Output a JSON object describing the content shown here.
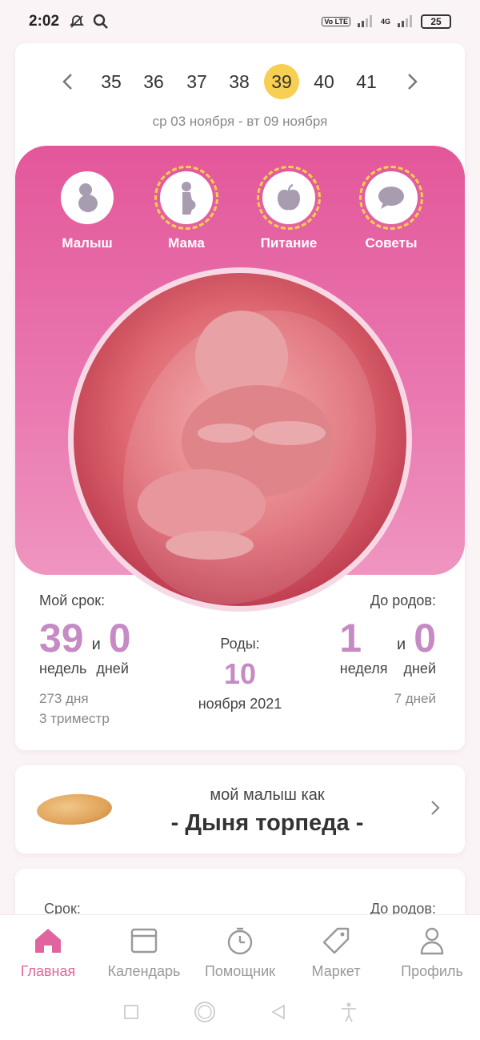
{
  "status_bar": {
    "time": "2:02",
    "network": "4G",
    "volte": "Vo LTE",
    "battery": "25"
  },
  "week_selector": {
    "weeks": [
      "35",
      "36",
      "37",
      "38",
      "39",
      "40",
      "41"
    ],
    "selected": "39",
    "date_range": "ср 03 ноября - вт 09 ноября"
  },
  "tabs": [
    {
      "label": "Малыш",
      "icon": "baby-icon"
    },
    {
      "label": "Мама",
      "icon": "pregnant-mom-icon"
    },
    {
      "label": "Питание",
      "icon": "apple-icon"
    },
    {
      "label": "Советы",
      "icon": "chat-bubble-icon"
    }
  ],
  "term": {
    "caption": "Мой срок:",
    "weeks": "39",
    "and": "и",
    "days": "0",
    "weeks_unit": "недель",
    "days_unit": "дней",
    "total_days": "273 дня",
    "trimester": "3 триместр"
  },
  "birth": {
    "caption": "Роды:",
    "day": "10",
    "month_year": "ноября 2021"
  },
  "until": {
    "caption": "До родов:",
    "weeks": "1",
    "and": "и",
    "days": "0",
    "weeks_unit": "неделя",
    "days_unit": "дней",
    "total": "7 дней"
  },
  "fruit": {
    "caption": "мой малыш как",
    "name": "- Дыня торпеда -"
  },
  "second_card": {
    "left": "Срок:",
    "right": "До родов:"
  },
  "bottom_nav": [
    {
      "label": "Главная",
      "icon": "home-icon",
      "active": true
    },
    {
      "label": "Календарь",
      "icon": "calendar-icon",
      "active": false
    },
    {
      "label": "Помощник",
      "icon": "stopwatch-icon",
      "active": false
    },
    {
      "label": "Маркет",
      "icon": "tag-icon",
      "active": false
    },
    {
      "label": "Профиль",
      "icon": "profile-icon",
      "active": false
    }
  ],
  "colors": {
    "accent": "#e0659e",
    "highlight": "#f7cf52",
    "number": "#c68ac4"
  }
}
